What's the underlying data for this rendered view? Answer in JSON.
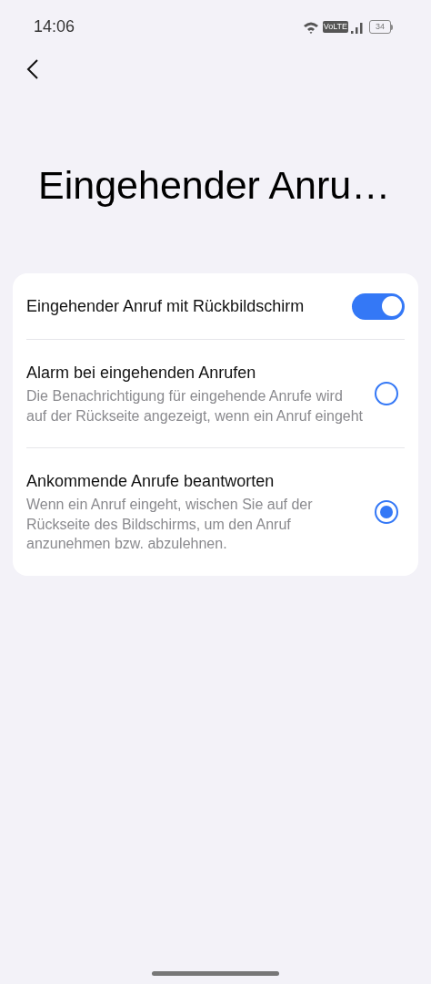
{
  "status_bar": {
    "time": "14:06",
    "network": "VoLTE",
    "battery": "34"
  },
  "page": {
    "title": "Eingehender Anru…"
  },
  "settings": [
    {
      "kind": "toggle",
      "title": "Eingehender Anruf mit Rückbildschirm",
      "on": true
    },
    {
      "kind": "radio",
      "title": "Alarm bei eingehenden Anrufen",
      "description": "Die Benachrichtigung für eingehende Anrufe wird auf der Rückseite angezeigt, wenn ein Anruf eingeht",
      "selected": false
    },
    {
      "kind": "radio",
      "title": "Ankommende Anrufe beantworten",
      "description": "Wenn ein Anruf eingeht, wischen Sie auf der Rückseite des Bildschirms, um den Anruf anzunehmen bzw. abzulehnen.",
      "selected": true
    }
  ]
}
